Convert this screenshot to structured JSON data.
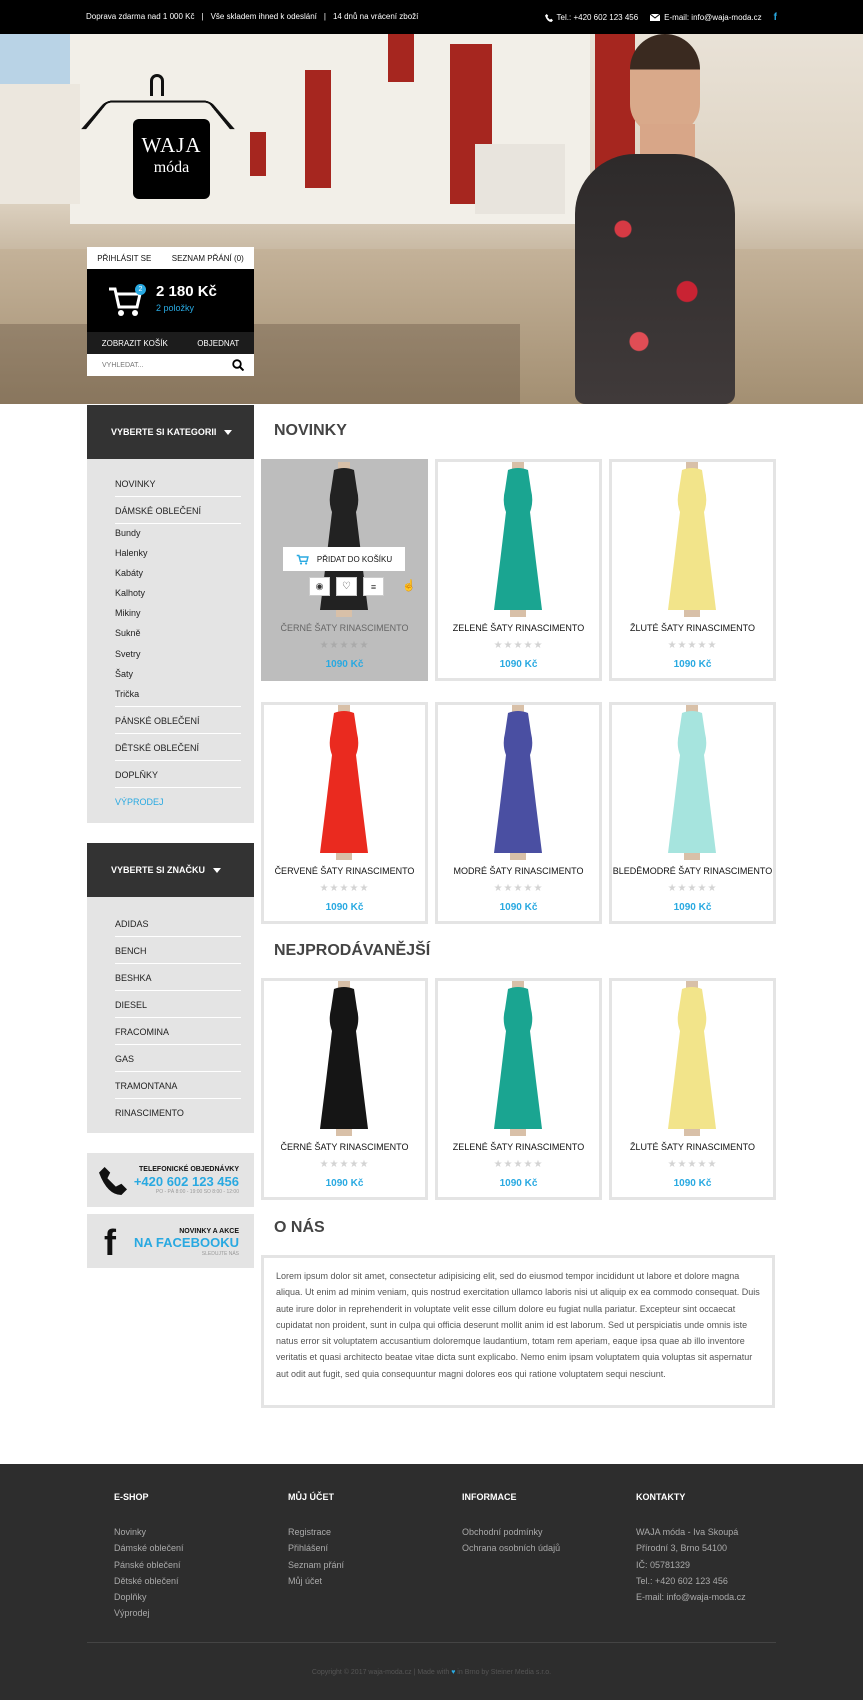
{
  "topbar": {
    "shipping": "Doprava zdarma nad 1 000 Kč",
    "stock": "Vše skladem ihned k odeslání",
    "returns": "14 dnů na vrácení zboží",
    "phone": "Tel.: +420 602 123 456",
    "email": "E-mail: info@waja-moda.cz",
    "separator": "|"
  },
  "logo": {
    "brand": "WAJA",
    "sub": "móda"
  },
  "account": {
    "login": "PŘIHLÁSIT SE",
    "wishlist": "SEZNAM PŘÁNÍ (0)"
  },
  "cart": {
    "badge": "2",
    "total": "2 180 Kč",
    "count": "2 položky",
    "view": "ZOBRAZIT KOŠÍK",
    "order": "OBJEDNAT"
  },
  "search": {
    "placeholder": "VYHLEDAT..."
  },
  "categories": {
    "title": "VYBERTE SI KATEGORII",
    "items": [
      "NOVINKY",
      "DÁMSKÉ OBLEČENÍ",
      "Bundy",
      "Halenky",
      "Kabáty",
      "Kalhoty",
      "Mikiny",
      "Sukně",
      "Svetry",
      "Šaty",
      "Trička",
      "PÁNSKÉ OBLEČENÍ",
      "DĚTSKÉ OBLEČENÍ",
      "DOPLŇKY",
      "VÝPRODEJ"
    ]
  },
  "brands": {
    "title": "VYBERTE SI ZNAČKU",
    "items": [
      "ADIDAS",
      "BENCH",
      "BESHKA",
      "DIESEL",
      "FRACOMINA",
      "GAS",
      "TRAMONTANA",
      "RINASCIMENTO"
    ]
  },
  "phone_promo": {
    "title": "TELEFONICKÉ OBJEDNÁVKY",
    "number": "+420 602 123 456",
    "hours": "PO - PÁ 8:00 - 19:00 SO 8:00 - 12:00"
  },
  "fb_promo": {
    "title": "NOVINKY A AKCE",
    "big": "NA FACEBOOKU",
    "small": "SLEDUJTE NÁS"
  },
  "sections": {
    "new": "NOVINKY",
    "best": "NEJPRODÁVANĚJŠÍ",
    "about": "O NÁS"
  },
  "hover": {
    "add": "PŘIDAT DO KOŠÍKU"
  },
  "stars": "★★★★★",
  "products_new": [
    {
      "name": "ČERNÉ ŠATY RINASCIMENTO",
      "price": "1090 Kč",
      "color": "#222222"
    },
    {
      "name": "ZELENÉ ŠATY RINASCIMENTO",
      "price": "1090 Kč",
      "color": "#1aa591"
    },
    {
      "name": "ŽLUTÉ ŠATY RINASCIMENTO",
      "price": "1090 Kč",
      "color": "#f2e48a"
    },
    {
      "name": "ČERVENÉ ŠATY RINASCIMENTO",
      "price": "1090 Kč",
      "color": "#ea2a1f"
    },
    {
      "name": "MODRÉ ŠATY RINASCIMENTO",
      "price": "1090 Kč",
      "color": "#4a4fa2"
    },
    {
      "name": "BLEDĚMODRÉ ŠATY RINASCIMENTO",
      "price": "1090 Kč",
      "color": "#a6e4de"
    }
  ],
  "products_best": [
    {
      "name": "ČERNÉ ŠATY RINASCIMENTO",
      "price": "1090 Kč",
      "color": "#151515"
    },
    {
      "name": "ZELENÉ ŠATY RINASCIMENTO",
      "price": "1090 Kč",
      "color": "#1aa591"
    },
    {
      "name": "ŽLUTÉ ŠATY RINASCIMENTO",
      "price": "1090 Kč",
      "color": "#f2e48a"
    }
  ],
  "about_text": "Lorem ipsum dolor sit amet, consectetur adipisicing elit, sed do eiusmod tempor incididunt ut labore et dolore magna aliqua. Ut enim ad minim veniam, quis nostrud exercitation ullamco laboris nisi ut aliquip ex ea commodo consequat. Duis aute irure dolor in reprehenderit in voluptate velit esse cillum dolore eu fugiat nulla pariatur. Excepteur sint occaecat cupidatat non proident, sunt in culpa qui officia deserunt mollit anim id est laborum. Sed ut perspiciatis unde omnis iste natus error sit voluptatem accusantium doloremque laudantium, totam rem aperiam, eaque ipsa quae ab illo inventore veritatis et quasi architecto beatae vitae dicta sunt explicabo. Nemo enim ipsam voluptatem quia voluptas sit aspernatur aut odit aut fugit, sed quia consequuntur magni dolores eos qui ratione voluptatem sequi nesciunt.",
  "footer": {
    "eshop": {
      "title": "E-SHOP",
      "links": [
        "Novinky",
        "Dámské oblečení",
        "Pánské oblečení",
        "Dětské oblečení",
        "Doplňky",
        "Výprodej"
      ]
    },
    "account": {
      "title": "MŮJ ÚČET",
      "links": [
        "Registrace",
        "Přihlášení",
        "Seznam přání",
        "Můj účet"
      ]
    },
    "info": {
      "title": "INFORMACE",
      "links": [
        "Obchodní podmínky",
        "Ochrana osobních údajů"
      ]
    },
    "contacts": {
      "title": "KONTAKTY",
      "lines": [
        "WAJA móda - Iva Skoupá",
        "Přírodní 3, Brno 54100",
        "IČ: 05781329",
        "Tel.: +420 602 123 456",
        "E-mail: info@waja-moda.cz"
      ]
    },
    "copy_a": "Copyright © 2017 waja-moda.cz | Made with",
    "heart": "♥",
    "copy_b": "in Brno by Steiner Media s.r.o."
  },
  "colors": {
    "accent": "#29a9e1",
    "dark": "#333333",
    "panel": "#e4e4e4",
    "footer": "#2d2d2d"
  }
}
